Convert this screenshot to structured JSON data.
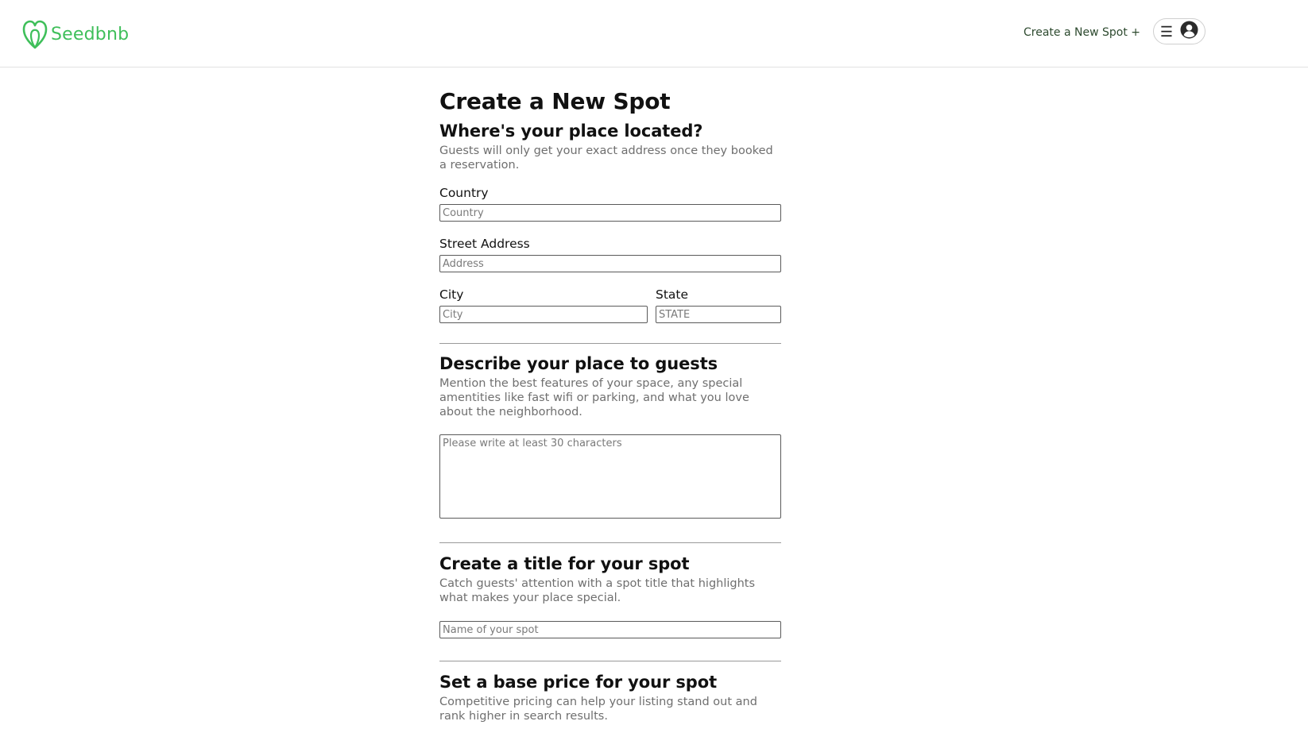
{
  "header": {
    "logo_text": "Seedbnb",
    "brand_color": "#3fbf5a",
    "create_spot_link": "Create a New Spot +",
    "menu_icon": "hamburger-icon",
    "profile_icon": "user-circle-icon"
  },
  "form": {
    "title": "Create a New Spot",
    "location": {
      "heading": "Where's your place located?",
      "description": "Guests will only get your exact address once they booked a reservation.",
      "country_label": "Country",
      "country_placeholder": "Country",
      "country_value": "",
      "street_label": "Street Address",
      "street_placeholder": "Address",
      "street_value": "",
      "city_label": "City",
      "city_placeholder": "City",
      "city_value": "",
      "state_label": "State",
      "state_placeholder": "STATE",
      "state_value": ""
    },
    "describe": {
      "heading": "Describe your place to guests",
      "description": "Mention the best features of your space, any special amentities like fast wifi or parking, and what you love about the neighborhood.",
      "placeholder": "Please write at least 30 characters",
      "value": ""
    },
    "title_section": {
      "heading": "Create a title for your spot",
      "description": "Catch guests' attention with a spot title that highlights what makes your place special.",
      "placeholder": "Name of your spot",
      "value": ""
    },
    "price": {
      "heading": "Set a base price for your spot",
      "description": "Competitive pricing can help your listing stand out and rank higher in search results."
    }
  }
}
